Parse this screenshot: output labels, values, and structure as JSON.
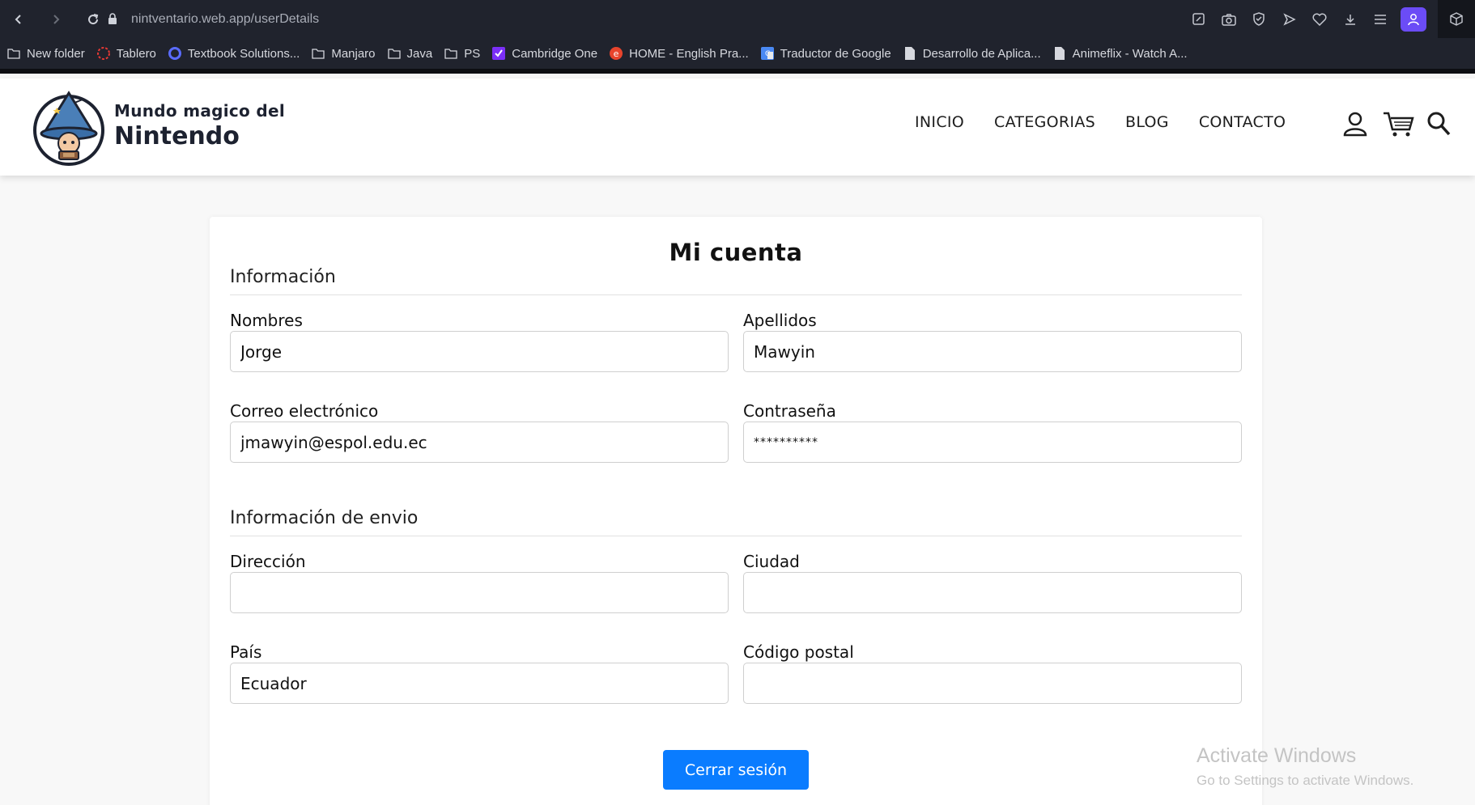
{
  "browser": {
    "url": "nintventario.web.app/userDetails",
    "bookmarks": [
      {
        "label": "New folder",
        "icon": "folder-icon"
      },
      {
        "label": "Tablero",
        "icon": "tablero-icon"
      },
      {
        "label": "Textbook Solutions...",
        "icon": "search-circle-icon"
      },
      {
        "label": "Manjaro",
        "icon": "folder-icon"
      },
      {
        "label": "Java",
        "icon": "folder-icon"
      },
      {
        "label": "PS",
        "icon": "folder-icon"
      },
      {
        "label": "Cambridge One",
        "icon": "cambridge-icon"
      },
      {
        "label": "HOME - English Pra...",
        "icon": "e-icon"
      },
      {
        "label": "Traductor de Google",
        "icon": "translate-icon"
      },
      {
        "label": "Desarrollo de Aplica...",
        "icon": "doc-icon"
      },
      {
        "label": "Animeflix - Watch A...",
        "icon": "doc-icon"
      }
    ]
  },
  "site": {
    "brand_line1": "Mundo magico del",
    "brand_line2": "Nintendo",
    "nav": [
      "INICIO",
      "CATEGORIAS",
      "BLOG",
      "CONTACTO"
    ]
  },
  "account": {
    "title": "Mi cuenta",
    "info_section": "Información",
    "shipping_section": "Información de envio",
    "fields": {
      "first_name": {
        "label": "Nombres",
        "value": "Jorge"
      },
      "last_name": {
        "label": "Apellidos",
        "value": "Mawyin"
      },
      "email": {
        "label": "Correo electrónico",
        "value": "jmawyin@espol.edu.ec"
      },
      "password": {
        "label": "Contraseña",
        "value": "**********"
      },
      "address": {
        "label": "Dirección",
        "value": ""
      },
      "city": {
        "label": "Ciudad",
        "value": ""
      },
      "country": {
        "label": "País",
        "value": "Ecuador"
      },
      "postal_code": {
        "label": "Código postal",
        "value": ""
      }
    },
    "logout_label": "Cerrar sesión"
  },
  "watermark": {
    "line1": "Activate Windows",
    "line2": "Go to Settings to activate Windows."
  },
  "colors": {
    "accent": "#0a7cff",
    "browser_bg": "#20232d",
    "profile": "#6b4cf6"
  }
}
